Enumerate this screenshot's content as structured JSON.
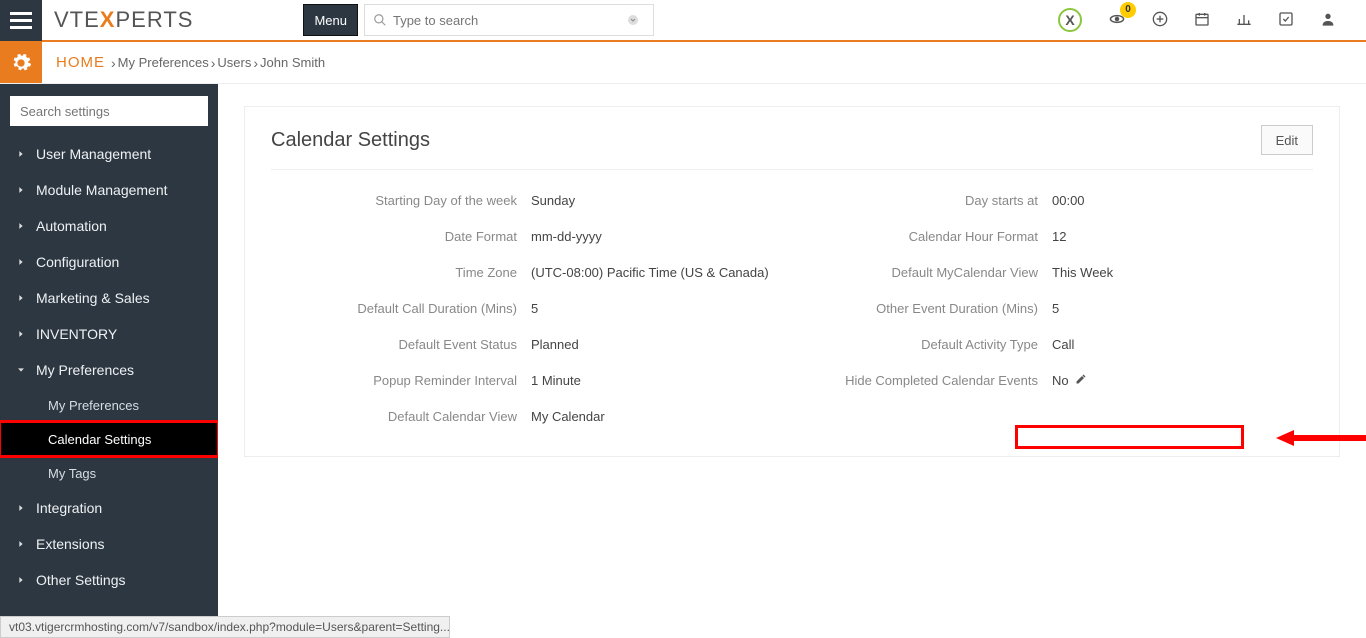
{
  "header": {
    "logo_a": "VTE",
    "logo_x": "X",
    "logo_b": "PERTS",
    "menu_label": "Menu",
    "search_placeholder": "Type to search",
    "notif_count": "0"
  },
  "breadcrumb": {
    "home": "HOME",
    "items": [
      "My Preferences",
      "Users",
      "John Smith"
    ]
  },
  "sidebar": {
    "search_placeholder": "Search settings",
    "items": [
      {
        "label": "User Management",
        "icon": "chev-right",
        "sub": []
      },
      {
        "label": "Module Management",
        "icon": "chev-right",
        "sub": []
      },
      {
        "label": "Automation",
        "icon": "chev-right",
        "sub": []
      },
      {
        "label": "Configuration",
        "icon": "chev-right",
        "sub": []
      },
      {
        "label": "Marketing & Sales",
        "icon": "chev-right",
        "sub": []
      },
      {
        "label": "INVENTORY",
        "icon": "chev-right",
        "sub": []
      },
      {
        "label": "My Preferences",
        "icon": "chev-down",
        "sub": [
          {
            "label": "My Preferences",
            "active": false,
            "highlight": false
          },
          {
            "label": "Calendar Settings",
            "active": true,
            "highlight": true
          },
          {
            "label": "My Tags",
            "active": false,
            "highlight": false
          }
        ]
      },
      {
        "label": "Integration",
        "icon": "chev-right",
        "sub": []
      },
      {
        "label": "Extensions",
        "icon": "chev-right",
        "sub": []
      },
      {
        "label": "Other Settings",
        "icon": "chev-right",
        "sub": []
      }
    ]
  },
  "panel": {
    "title": "Calendar Settings",
    "edit_label": "Edit",
    "left_fields": [
      {
        "label": "Starting Day of the week",
        "value": "Sunday"
      },
      {
        "label": "Date Format",
        "value": "mm-dd-yyyy"
      },
      {
        "label": "Time Zone",
        "value": "(UTC-08:00) Pacific Time (US & Canada)"
      },
      {
        "label": "Default Call Duration (Mins)",
        "value": "5"
      },
      {
        "label": "Default Event Status",
        "value": "Planned"
      },
      {
        "label": "Popup Reminder Interval",
        "value": "1 Minute"
      },
      {
        "label": "Default Calendar View",
        "value": "My Calendar"
      }
    ],
    "right_fields": [
      {
        "label": "Day starts at",
        "value": "00:00"
      },
      {
        "label": "Calendar Hour Format",
        "value": "12"
      },
      {
        "label": "Default MyCalendar View",
        "value": "This Week"
      },
      {
        "label": "Other Event Duration (Mins)",
        "value": "5"
      },
      {
        "label": "Default Activity Type",
        "value": "Call"
      },
      {
        "label": "Hide Completed Calendar Events",
        "value": "No",
        "editable": true
      }
    ]
  },
  "statusbar": "vt03.vtigercrmhosting.com/v7/sandbox/index.php?module=Users&parent=Setting..."
}
